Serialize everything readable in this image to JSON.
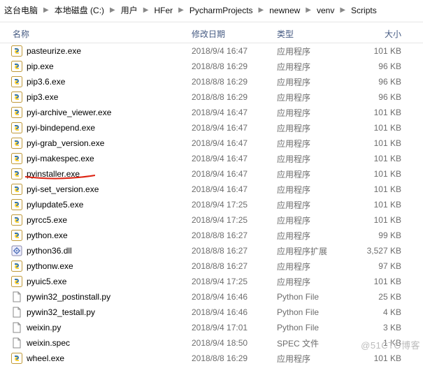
{
  "breadcrumb": [
    "这台电脑",
    "本地磁盘 (C:)",
    "用户",
    "HFer",
    "PycharmProjects",
    "newnew",
    "venv",
    "Scripts"
  ],
  "columns": {
    "name": "名称",
    "date": "修改日期",
    "type": "类型",
    "size": "大小"
  },
  "watermark": "@51CTO博客",
  "type_labels": {
    "app": "应用程序",
    "appext": "应用程序扩展",
    "py": "Python File",
    "spec": "SPEC 文件"
  },
  "files": [
    {
      "name": "pasteurize.exe",
      "date": "2018/9/4 16:47",
      "type": "app",
      "size": "101 KB",
      "icon": "exe-py"
    },
    {
      "name": "pip.exe",
      "date": "2018/8/8 16:29",
      "type": "app",
      "size": "96 KB",
      "icon": "exe-py"
    },
    {
      "name": "pip3.6.exe",
      "date": "2018/8/8 16:29",
      "type": "app",
      "size": "96 KB",
      "icon": "exe-py"
    },
    {
      "name": "pip3.exe",
      "date": "2018/8/8 16:29",
      "type": "app",
      "size": "96 KB",
      "icon": "exe-py"
    },
    {
      "name": "pyi-archive_viewer.exe",
      "date": "2018/9/4 16:47",
      "type": "app",
      "size": "101 KB",
      "icon": "exe-py"
    },
    {
      "name": "pyi-bindepend.exe",
      "date": "2018/9/4 16:47",
      "type": "app",
      "size": "101 KB",
      "icon": "exe-py"
    },
    {
      "name": "pyi-grab_version.exe",
      "date": "2018/9/4 16:47",
      "type": "app",
      "size": "101 KB",
      "icon": "exe-py"
    },
    {
      "name": "pyi-makespec.exe",
      "date": "2018/9/4 16:47",
      "type": "app",
      "size": "101 KB",
      "icon": "exe-py"
    },
    {
      "name": "pyinstaller.exe",
      "date": "2018/9/4 16:47",
      "type": "app",
      "size": "101 KB",
      "icon": "exe-py",
      "highlight": true
    },
    {
      "name": "pyi-set_version.exe",
      "date": "2018/9/4 16:47",
      "type": "app",
      "size": "101 KB",
      "icon": "exe-py"
    },
    {
      "name": "pylupdate5.exe",
      "date": "2018/9/4 17:25",
      "type": "app",
      "size": "101 KB",
      "icon": "exe-py"
    },
    {
      "name": "pyrcc5.exe",
      "date": "2018/9/4 17:25",
      "type": "app",
      "size": "101 KB",
      "icon": "exe-py"
    },
    {
      "name": "python.exe",
      "date": "2018/8/8 16:27",
      "type": "app",
      "size": "99 KB",
      "icon": "exe-py"
    },
    {
      "name": "python36.dll",
      "date": "2018/8/8 16:27",
      "type": "appext",
      "size": "3,527 KB",
      "icon": "dll"
    },
    {
      "name": "pythonw.exe",
      "date": "2018/8/8 16:27",
      "type": "app",
      "size": "97 KB",
      "icon": "exe-py"
    },
    {
      "name": "pyuic5.exe",
      "date": "2018/9/4 17:25",
      "type": "app",
      "size": "101 KB",
      "icon": "exe-py"
    },
    {
      "name": "pywin32_postinstall.py",
      "date": "2018/9/4 16:46",
      "type": "py",
      "size": "25 KB",
      "icon": "file"
    },
    {
      "name": "pywin32_testall.py",
      "date": "2018/9/4 16:46",
      "type": "py",
      "size": "4 KB",
      "icon": "file"
    },
    {
      "name": "weixin.py",
      "date": "2018/9/4 17:01",
      "type": "py",
      "size": "3 KB",
      "icon": "file"
    },
    {
      "name": "weixin.spec",
      "date": "2018/9/4 18:50",
      "type": "spec",
      "size": "1 KB",
      "icon": "file"
    },
    {
      "name": "wheel.exe",
      "date": "2018/8/8 16:29",
      "type": "app",
      "size": "101 KB",
      "icon": "exe-py"
    }
  ]
}
